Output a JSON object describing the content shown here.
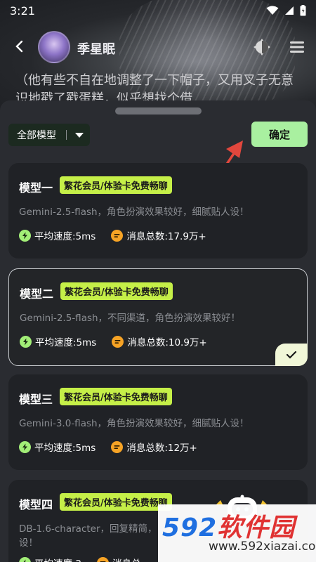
{
  "status_bar": {
    "time": "3:21"
  },
  "header": {
    "character_name": "季星眠"
  },
  "narration": "（他有些不自在地调整了一下帽子，又用叉子无意识地戳了戳蛋糕，似乎想找个借",
  "sheet": {
    "filter_label": "全部模型",
    "confirm_label": "确定",
    "models": [
      {
        "name": "模型一",
        "badge": "繁花会员/体验卡免费畅聊",
        "desc": "Gemini-2.5-flash，角色扮演效果较好，细腻贴人设！",
        "speed": "平均速度:5ms",
        "messages": "消息总数:17.9万+",
        "selected": false
      },
      {
        "name": "模型二",
        "badge": "繁花会员/体验卡免费畅聊",
        "desc": "Gemini-2.5-flash，不同渠道，角色扮演效果较好！",
        "speed": "平均速度:5ms",
        "messages": "消息总数:10.9万+",
        "selected": true
      },
      {
        "name": "模型三",
        "badge": "繁花会员/体验卡免费畅聊",
        "desc": "Gemini-3.0-flash，角色扮演效果较好，细腻贴人设！",
        "speed": "平均速度:5ms",
        "messages": "消息总数:12万+",
        "selected": false
      },
      {
        "name": "模型四",
        "badge": "繁花会员/体验卡免费畅聊",
        "desc": "DB-1.6-character，回复精简，",
        "desc2": "设！",
        "speed": "平均速度:2",
        "messages": "消息总",
        "selected": false
      }
    ]
  },
  "watermark": {
    "logo_num": "592",
    "logo_cn": "软件园",
    "url": "www.592xiazai.com"
  },
  "colors": {
    "accent_green": "#a9f0a0",
    "badge_lime": "#c5ef48",
    "arrow_red": "#e2473d"
  }
}
